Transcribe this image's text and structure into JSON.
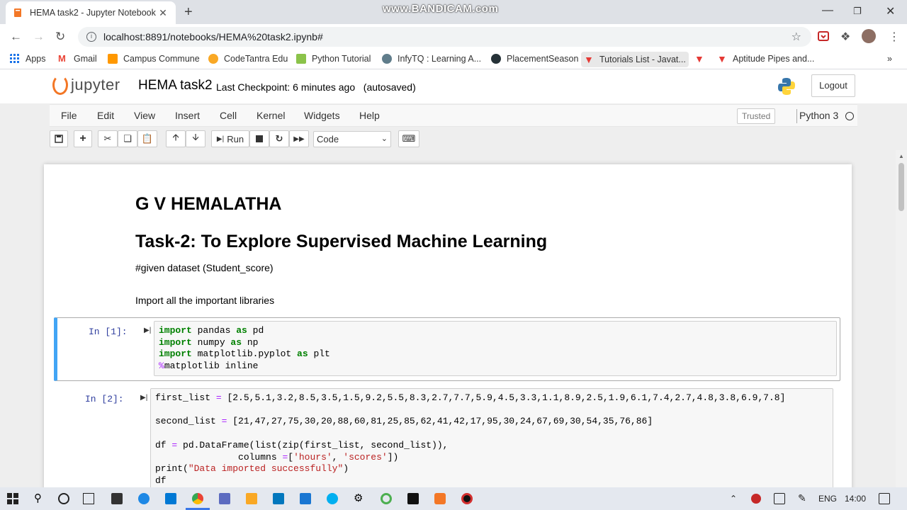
{
  "browser": {
    "tab_title": "HEMA task2 - Jupyter Notebook",
    "tab_close": "✕",
    "new_tab": "+",
    "watermark": "www.BANDICAM.com",
    "url": "localhost:8891/notebooks/HEMA%20task2.ipynb#",
    "bookmarks": [
      {
        "label": "Apps",
        "icon": "apps-grid-icon",
        "color": "#1a73e8"
      },
      {
        "label": "Gmail",
        "icon": "gmail-icon",
        "color": "#ea4335"
      },
      {
        "label": "Campus Commune",
        "icon": "campus-icon",
        "color": "#ff9800"
      },
      {
        "label": "CodeTantra Edu",
        "icon": "codetantra-icon",
        "color": "#f9a825"
      },
      {
        "label": "Python Tutorial",
        "icon": "python-tutorial-icon",
        "color": "#8bc34a"
      },
      {
        "label": "InfyTQ : Learning A...",
        "icon": "infytq-icon",
        "color": "#607d8b"
      },
      {
        "label": "PlacementSeason",
        "icon": "placement-icon",
        "color": "#263238"
      },
      {
        "label": "Tutorials List - Javat...",
        "icon": "javatpoint-icon",
        "color": "#e53935"
      },
      {
        "label": "",
        "icon": "javatpoint-icon",
        "color": "#e53935"
      },
      {
        "label": "Aptitude Pipes and...",
        "icon": "javatpoint-icon",
        "color": "#e53935"
      }
    ],
    "more": "»"
  },
  "jupyter": {
    "logo_text": "jupyter",
    "notebook_name": "HEMA task2",
    "checkpoint": "Last Checkpoint: 6 minutes ago",
    "autosave": "(autosaved)",
    "logout": "Logout",
    "menus": [
      "File",
      "Edit",
      "View",
      "Insert",
      "Cell",
      "Kernel",
      "Widgets",
      "Help"
    ],
    "trusted": "Trusted",
    "kernel_name": "Python 3",
    "run_label": "Run",
    "cell_type": "Code"
  },
  "notebook": {
    "heading1": "G V HEMALATHA",
    "heading2": "Task-2: To Explore Supervised Machine Learning",
    "para1": "#given dataset (Student_score)",
    "para2": "Import all the important libraries",
    "cell1_prompt": "In [1]:",
    "cell2_prompt": "In [2]:"
  },
  "taskbar": {
    "lang": "ENG",
    "time": "14:00"
  }
}
